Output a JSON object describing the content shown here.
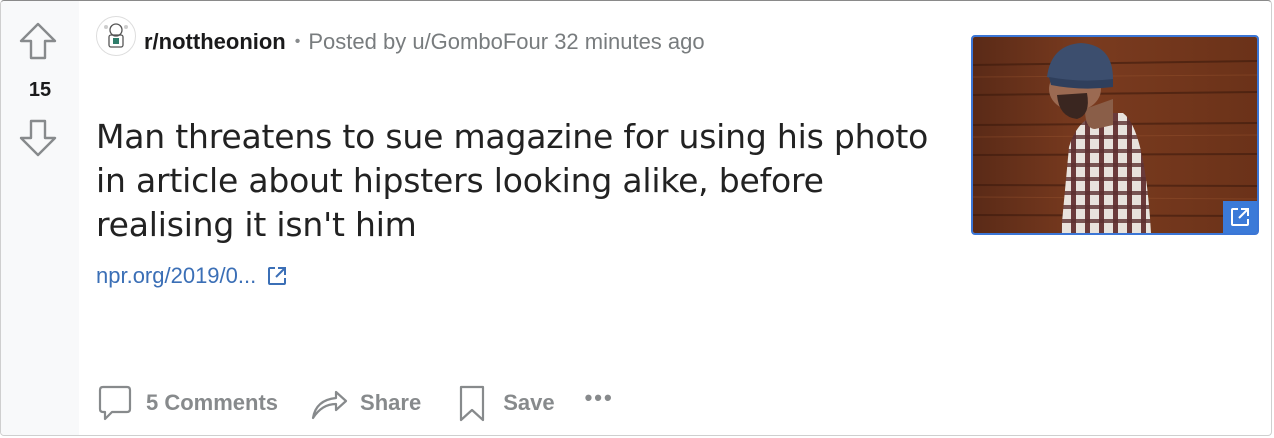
{
  "vote": {
    "score": "15"
  },
  "post": {
    "subreddit": "r/nottheonion",
    "separator": "•",
    "posted_prefix": "Posted by",
    "author": "u/GomboFour",
    "time": "32 minutes ago",
    "title": "Man threatens to sue magazine for using his photo in article about hipsters looking alike, before realising it isn't him",
    "link_text": "npr.org/2019/0..."
  },
  "actions": {
    "comments_label": "5 Comments",
    "share_label": "Share",
    "save_label": "Save",
    "more_label": "•••"
  },
  "icons": {
    "upvote": "arrow-up-icon",
    "downvote": "arrow-down-icon",
    "external_link": "external-link-icon",
    "comment": "comment-icon",
    "share": "share-icon",
    "save": "bookmark-icon"
  },
  "colors": {
    "link": "#3b6fb6",
    "accent": "#3b7ad8",
    "muted": "#878a8c"
  }
}
